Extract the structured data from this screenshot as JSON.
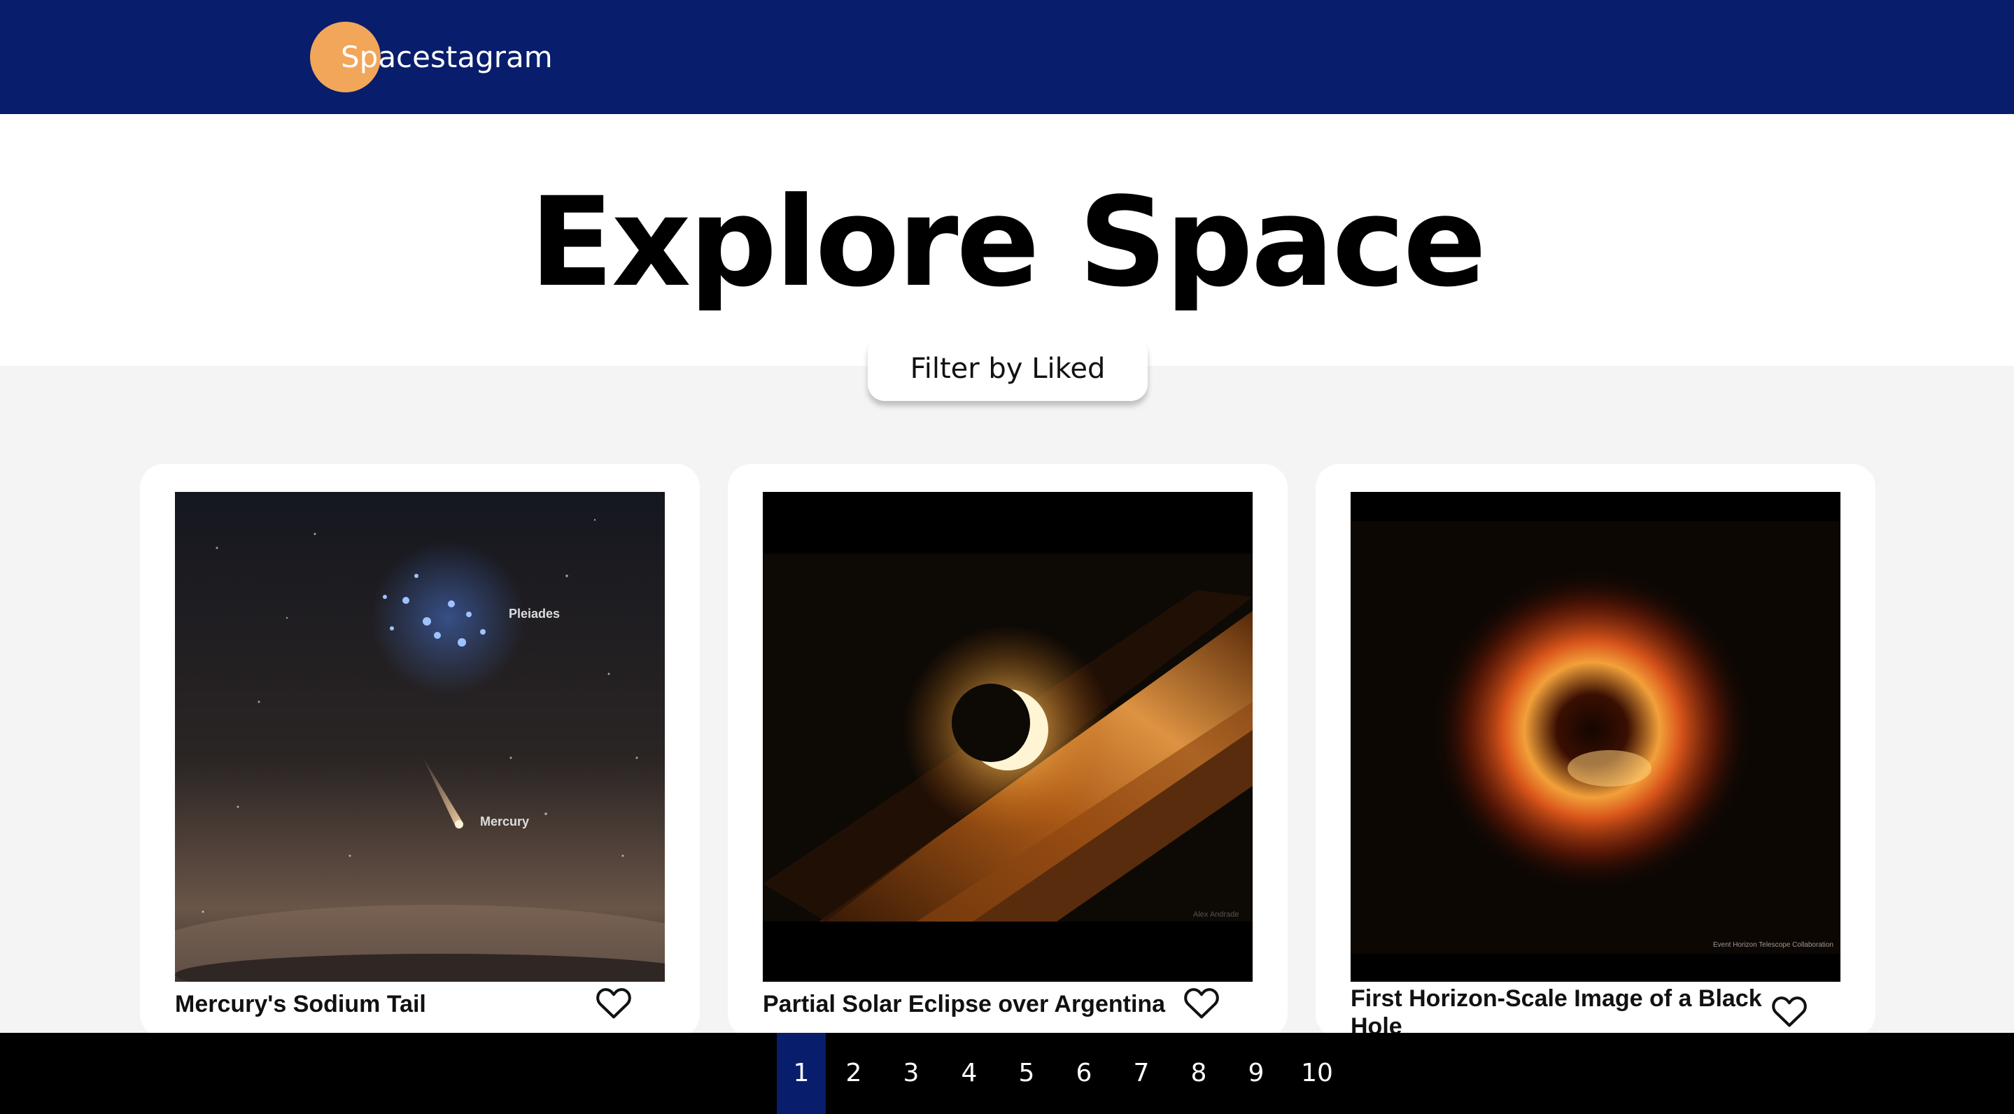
{
  "header": {
    "brand": "Spacestagram",
    "brand_color": "#081d6b",
    "logo_color": "#f2a65a"
  },
  "hero": {
    "title": "Explore Space"
  },
  "filter": {
    "label": "Filter by Liked"
  },
  "cards": [
    {
      "title": "Mercury's Sodium Tail",
      "image_labels": [
        "Pleiades",
        "Mercury"
      ],
      "liked": false
    },
    {
      "title": "Partial Solar Eclipse over Argentina",
      "image_labels": [
        "Alex Andrade"
      ],
      "liked": false
    },
    {
      "title": "First Horizon-Scale Image of a Black Hole",
      "image_labels": [
        "Event Horizon Telescope Collaboration"
      ],
      "liked": false
    }
  ],
  "pagination": {
    "pages": [
      "1",
      "2",
      "3",
      "4",
      "5",
      "6",
      "7",
      "8",
      "9",
      "10"
    ],
    "current": "1"
  },
  "icons": {
    "like": "heart-outline-icon"
  }
}
